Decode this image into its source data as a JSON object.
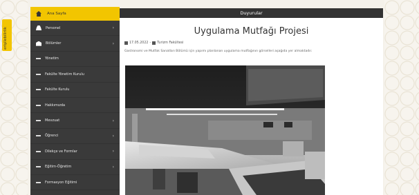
{
  "side_tab": {
    "label": "erişilebilirlik"
  },
  "sidebar": {
    "home_label": "Ana Sayfa",
    "items": [
      {
        "label": "Personel",
        "icon": "user-icon",
        "has_children": true
      },
      {
        "label": "Bölümler",
        "icon": "bank-icon",
        "has_children": true
      },
      {
        "label": "Yönetim",
        "icon": "dash-icon",
        "has_children": false
      },
      {
        "label": "Fakülte Yönetim Kurulu",
        "icon": "dash-icon",
        "has_children": false
      },
      {
        "label": "Fakülte Kurulu",
        "icon": "dash-icon",
        "has_children": false
      },
      {
        "label": "Hakkımızda",
        "icon": "dash-icon",
        "has_children": false
      },
      {
        "label": "Mevzuat",
        "icon": "dash-icon",
        "has_children": true
      },
      {
        "label": "Öğrenci",
        "icon": "dash-icon",
        "has_children": true
      },
      {
        "label": "Dilekçe ve Formlar",
        "icon": "dash-icon",
        "has_children": true
      },
      {
        "label": "Eğitim-Öğretim",
        "icon": "dash-icon",
        "has_children": true
      },
      {
        "label": "Formasyon Eğitimi",
        "icon": "dash-icon",
        "has_children": false
      }
    ],
    "chevron": "›"
  },
  "main": {
    "header_title": "Duyurular",
    "article_title": "Uygulama Mutfağı Projesi",
    "date": "17.05.2022",
    "separator": "-",
    "category": "Turizm Fakültesi",
    "description": "Gastronomi ve Mutfak Sanatları Bölümü için yapımı planlanan uygulama mutfağının görselleri aşağıda yer almaktadır."
  },
  "colors": {
    "accent": "#f2c500",
    "sidebar_bg": "#3a3a3a",
    "header_bg": "#333333"
  }
}
